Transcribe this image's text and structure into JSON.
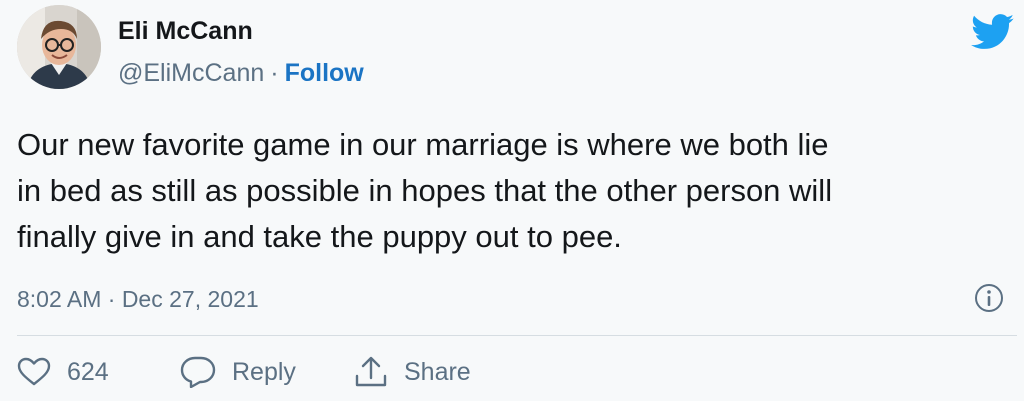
{
  "author": {
    "name": "Eli McCann",
    "handle": "@EliMcCann",
    "separator": "·",
    "follow_label": "Follow"
  },
  "tweet": {
    "lines": [
      "Our new favorite game in our marriage is where we both lie",
      "in bed as still as possible in hopes that the other person will",
      "finally give in and take the puppy out to pee."
    ],
    "timestamp": "8:02 AM · Dec 27, 2021"
  },
  "actions": {
    "like_count": "624",
    "reply_label": "Reply",
    "share_label": "Share"
  },
  "icons": {
    "brand": "twitter-bird-icon",
    "info": "info-icon",
    "like": "heart-icon",
    "reply": "speech-bubble-icon",
    "share": "share-arrow-icon"
  },
  "colors": {
    "background": "#f7f9fa",
    "text": "#14171a",
    "secondary": "#5b7083",
    "follow": "#1b74c4",
    "twitter_blue": "#1da1f2",
    "divider": "#d6dde2"
  }
}
